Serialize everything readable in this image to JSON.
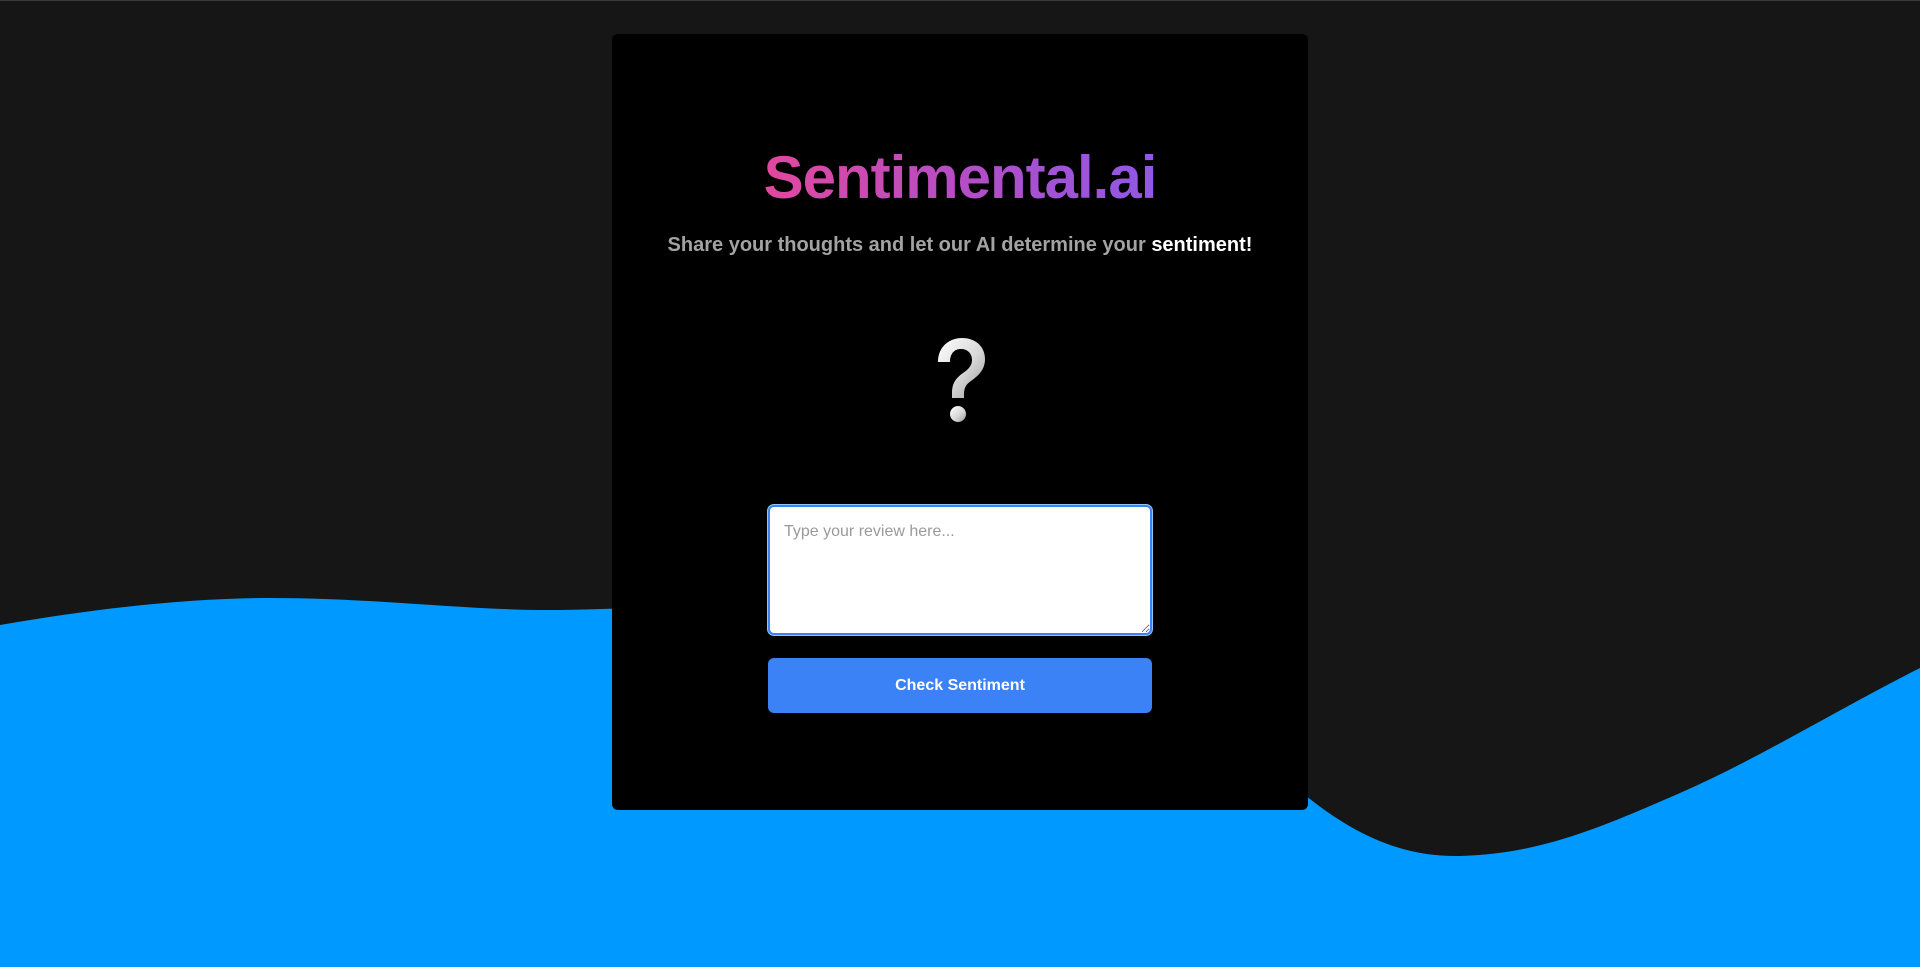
{
  "brand": {
    "title": "Sentimental.ai",
    "gradient_start": "#e2489e",
    "gradient_end": "#8f58e6"
  },
  "tagline": {
    "text": "Share your thoughts and let our AI determine your ",
    "highlight": "sentiment!"
  },
  "result": {
    "icon": "question-mark-icon",
    "symbol": "?"
  },
  "review": {
    "placeholder": "Type your review here...",
    "value": ""
  },
  "actions": {
    "check_label": "Check Sentiment"
  },
  "theme": {
    "background": "#161616",
    "card": "#000000",
    "wave": "#0099ff",
    "accent": "#3b82f6"
  }
}
